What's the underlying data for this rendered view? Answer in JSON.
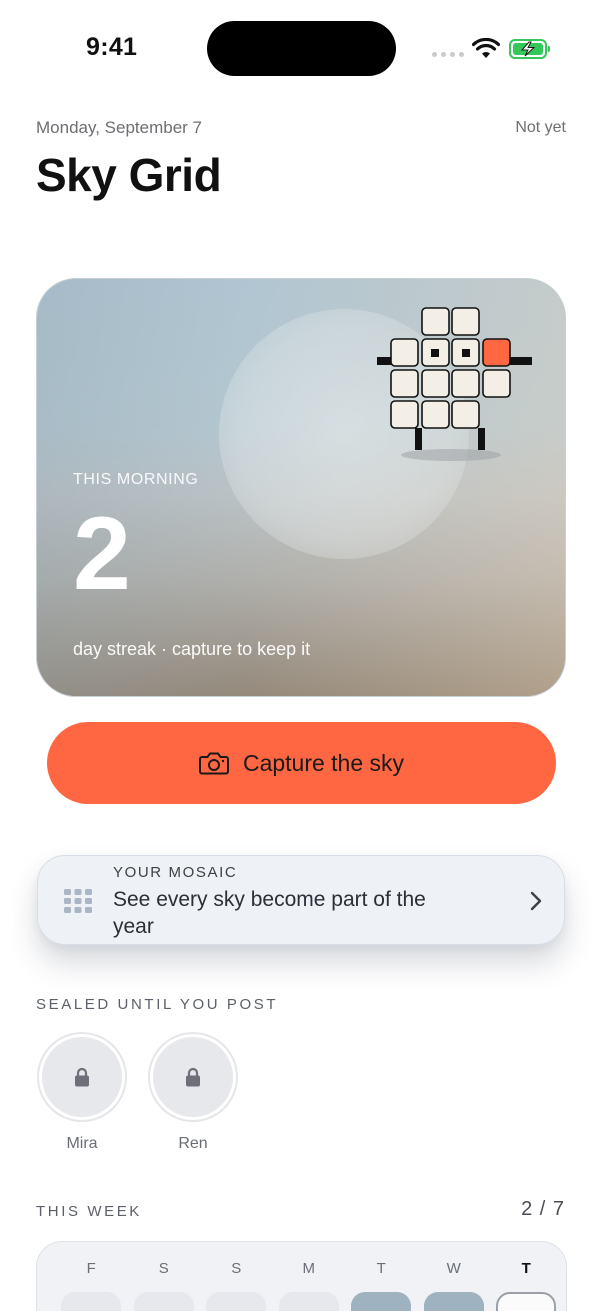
{
  "status_bar": {
    "time": "9:41"
  },
  "header": {
    "date": "Monday, September 7",
    "status": "Not yet",
    "title": "Sky Grid"
  },
  "hero": {
    "eyebrow": "THIS MORNING",
    "streak": "2",
    "subtitle": "day streak · capture to keep it",
    "accent_color": "#ff6743"
  },
  "capture_button": {
    "label": "Capture the sky",
    "icon": "camera-icon",
    "color": "#ff6743"
  },
  "mosaic": {
    "eyebrow": "YOUR MOSAIC",
    "text": "See every sky become part of the year",
    "icon": "grid-icon"
  },
  "sealed": {
    "label": "SEALED UNTIL YOU POST",
    "friends": [
      {
        "name": "Mira",
        "icon": "lock-icon"
      },
      {
        "name": "Ren",
        "icon": "lock-icon"
      }
    ]
  },
  "week": {
    "label": "THIS WEEK",
    "count": "2 / 7",
    "days": [
      {
        "letter": "F",
        "state": "empty"
      },
      {
        "letter": "S",
        "state": "empty"
      },
      {
        "letter": "S",
        "state": "empty"
      },
      {
        "letter": "M",
        "state": "empty"
      },
      {
        "letter": "T",
        "state": "done"
      },
      {
        "letter": "W",
        "state": "done"
      },
      {
        "letter": "T",
        "state": "today"
      }
    ]
  }
}
